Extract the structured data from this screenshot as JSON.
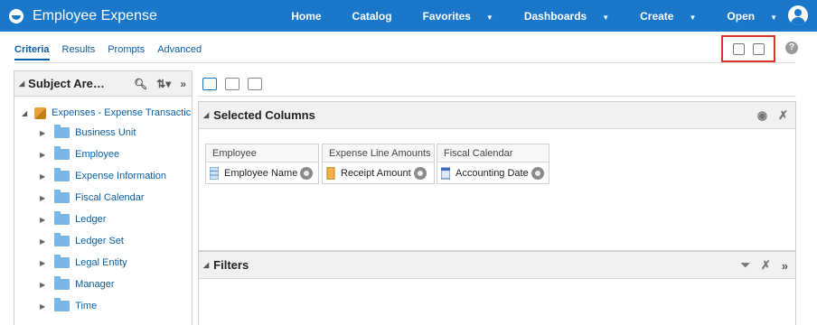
{
  "header": {
    "title": "Employee Expense",
    "nav": [
      {
        "label": "Home",
        "caret": false
      },
      {
        "label": "Catalog",
        "caret": false
      },
      {
        "label": "Favorites",
        "caret": true
      },
      {
        "label": "Dashboards",
        "caret": true
      },
      {
        "label": "Create",
        "caret": true
      },
      {
        "label": "Open",
        "caret": true
      }
    ]
  },
  "tabs": [
    {
      "label": "Criteria",
      "active": true
    },
    {
      "label": "Results",
      "active": false
    },
    {
      "label": "Prompts",
      "active": false
    },
    {
      "label": "Advanced",
      "active": false
    }
  ],
  "help_glyph": "?",
  "subject_areas": {
    "title": "Subject Are…",
    "root": "Expenses - Expense Transactic",
    "folders": [
      "Business Unit",
      "Employee",
      "Expense Information",
      "Fiscal Calendar",
      "Ledger",
      "Ledger Set",
      "Legal Entity",
      "Manager",
      "Time"
    ]
  },
  "selected_columns": {
    "title": "Selected Columns",
    "groups": [
      {
        "name": "Employee",
        "column": "Employee Name",
        "icon": "attribute-column-icon"
      },
      {
        "name": "Expense Line Amounts",
        "column": "Receipt Amount",
        "icon": "measure-column-icon"
      },
      {
        "name": "Fiscal Calendar",
        "column": "Accounting Date",
        "icon": "date-column-icon"
      }
    ]
  },
  "filters": {
    "title": "Filters"
  },
  "colors": {
    "brand": "#1a77c9",
    "highlight_box": "#d9332f"
  }
}
